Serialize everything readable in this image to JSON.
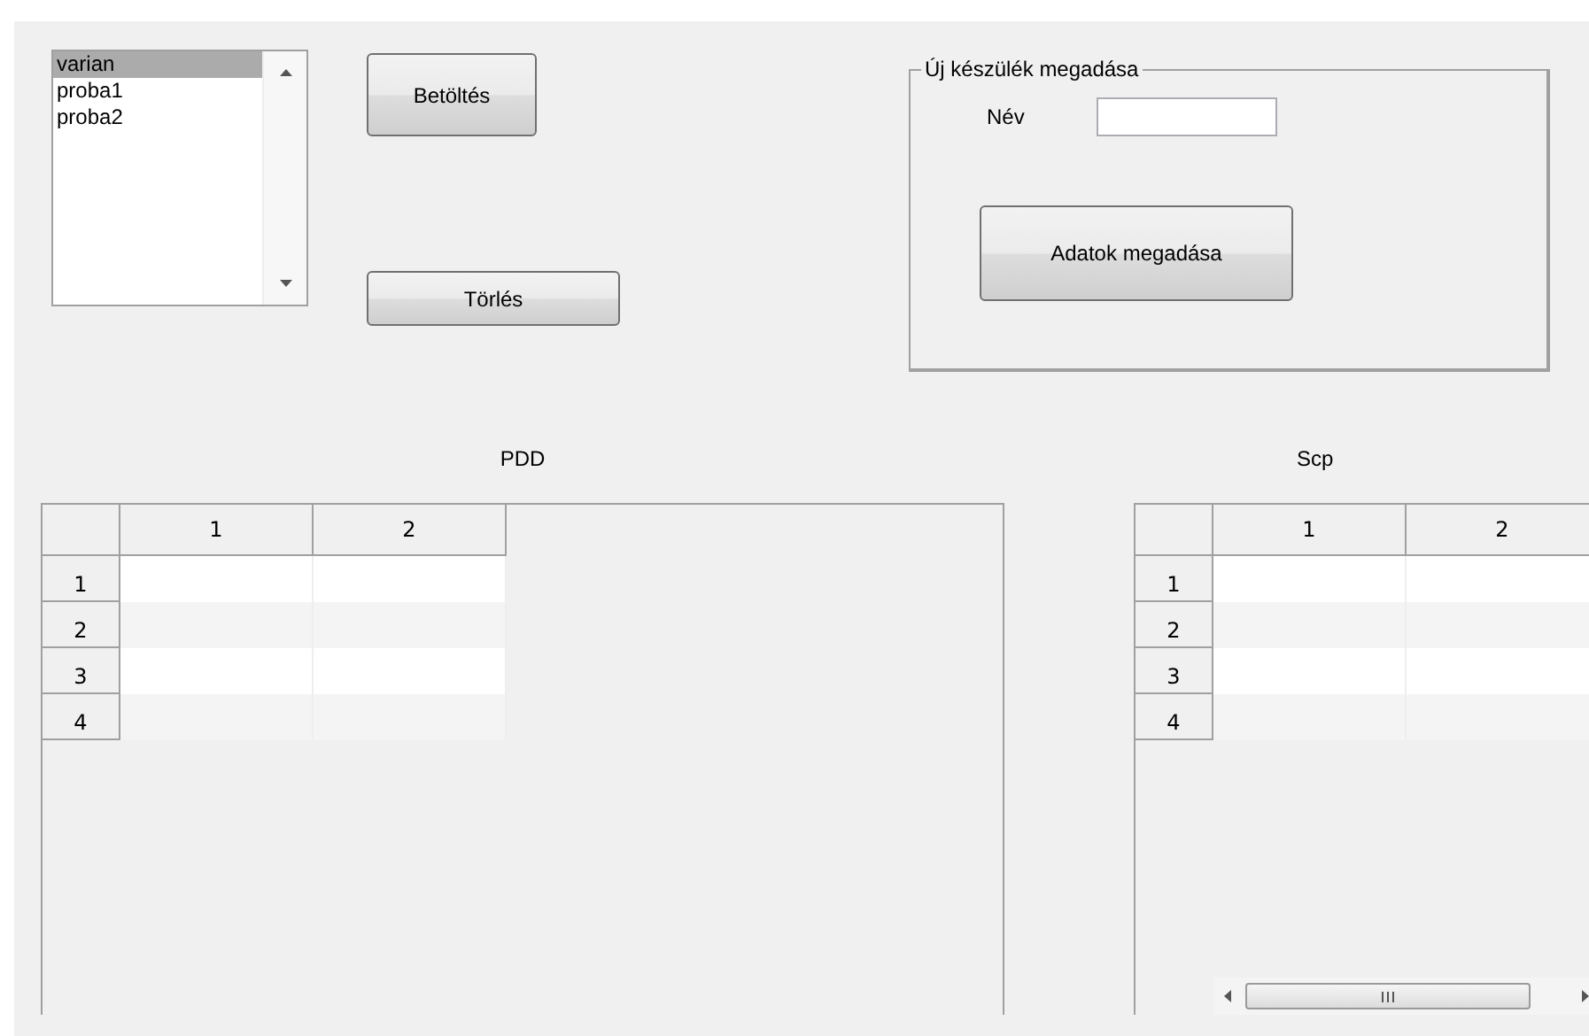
{
  "device_list": {
    "items": [
      {
        "label": "varian",
        "selected": true
      },
      {
        "label": "proba1",
        "selected": false
      },
      {
        "label": "proba2",
        "selected": false
      }
    ]
  },
  "load_button": "Betöltés",
  "delete_button": "Törlés",
  "new_device_panel": {
    "title": "Új készülék megadása",
    "name_label": "Név",
    "submit_button": "Adatok megadása"
  },
  "tables": [
    {
      "title": "PDD",
      "columns": [
        "1",
        "2"
      ],
      "row_labels": [
        "1",
        "2",
        "3",
        "4"
      ],
      "horizontal_scrollbar": false
    },
    {
      "title": "Scp",
      "columns": [
        "1",
        "2"
      ],
      "row_labels": [
        "1",
        "2",
        "3",
        "4"
      ],
      "horizontal_scrollbar": true
    }
  ]
}
